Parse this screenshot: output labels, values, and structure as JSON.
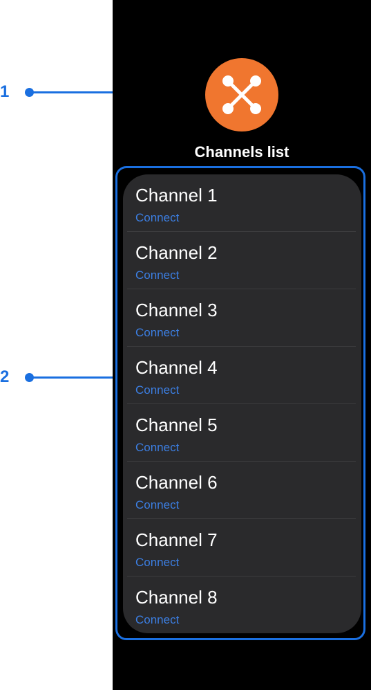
{
  "callouts": [
    {
      "label": "1"
    },
    {
      "label": "2"
    }
  ],
  "app": {
    "icon": "network-hub-icon",
    "icon_color": "#f0762f",
    "title": "Channels list"
  },
  "channels": [
    {
      "name": "Channel 1",
      "action": "Connect"
    },
    {
      "name": "Channel 2",
      "action": "Connect"
    },
    {
      "name": "Channel 3",
      "action": "Connect"
    },
    {
      "name": "Channel 4",
      "action": "Connect"
    },
    {
      "name": "Channel 5",
      "action": "Connect"
    },
    {
      "name": "Channel 6",
      "action": "Connect"
    },
    {
      "name": "Channel 7",
      "action": "Connect"
    },
    {
      "name": "Channel 8",
      "action": "Connect"
    }
  ],
  "colors": {
    "accent": "#1a6fe0",
    "link": "#3c7fe3",
    "list_background": "#2a2a2c",
    "screen_background": "#000000"
  }
}
